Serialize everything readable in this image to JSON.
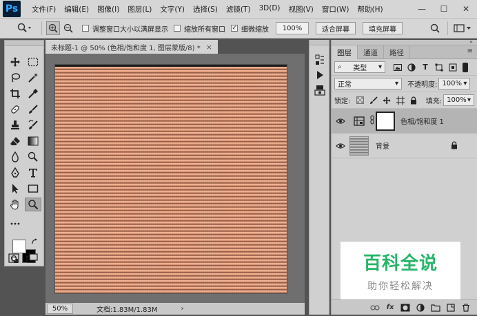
{
  "app": {
    "logo": "Ps"
  },
  "menu": [
    "文件(F)",
    "编辑(E)",
    "图像(I)",
    "图层(L)",
    "文字(Y)",
    "选择(S)",
    "滤镜(T)",
    "3D(D)",
    "视图(V)",
    "窗口(W)",
    "帮助(H)"
  ],
  "window_controls": {
    "minimize": "—",
    "maximize": "☐",
    "close": "✕"
  },
  "options": {
    "resize_windows_label": "调整窗口大小以满屏显示",
    "resize_windows_checked": false,
    "zoom_all_windows_label": "缩放所有窗口",
    "zoom_all_windows_checked": false,
    "scrubby_zoom_label": "细微缩放",
    "scrubby_zoom_checked": true,
    "zoom_value": "100%",
    "fit_screen_label": "适合屏幕",
    "fill_screen_label": "填充屏幕"
  },
  "document": {
    "tab_title": "未标题-1 @ 50% (色相/饱和度 1, 图层蒙版/8) *",
    "close": "×",
    "status_zoom": "50%",
    "status_info": "文档:1.83M/1.83M",
    "status_arrow": "›"
  },
  "layers_panel": {
    "tabs": [
      "图层",
      "通道",
      "路径"
    ],
    "filter_kind": "类型",
    "blend_mode": "正常",
    "opacity_label": "不透明度:",
    "opacity_value": "100%",
    "lock_label": "锁定:",
    "fill_label": "填充:",
    "fill_value": "100%",
    "layers": [
      {
        "name": "色相/饱和度 1",
        "visible": true,
        "selected": true
      },
      {
        "name": "背景",
        "visible": true,
        "selected": false,
        "locked": true
      }
    ]
  },
  "watermark": {
    "title": "百科全说",
    "subtitle": "助你轻松解决"
  },
  "colors": {
    "menu_bg": "#d6d6d6",
    "workspace": "#535353",
    "canvas_stripe_light": "#f4b596",
    "canvas_stripe_dark": "#6e3e2c",
    "watermark_green": "#27b56a"
  }
}
